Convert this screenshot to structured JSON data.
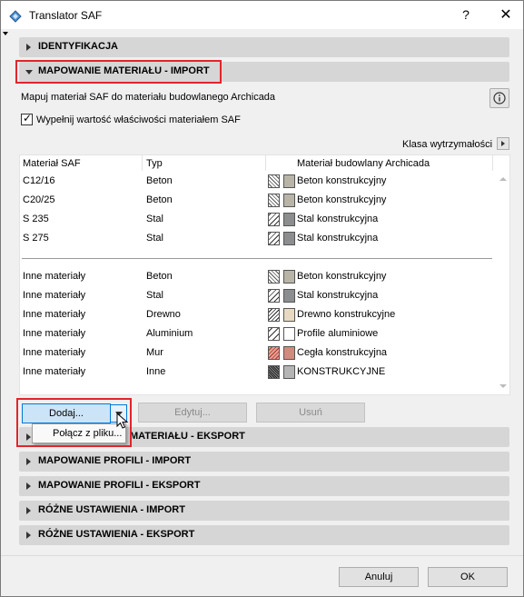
{
  "window": {
    "title": "Translator SAF",
    "help_label": "?",
    "close_label": "✕"
  },
  "sections": {
    "identyfikacja": "IDENTYFIKACJA",
    "mapowanie_import": "MAPOWANIE MATERIAŁU - IMPORT",
    "mapowanie_eksport": "MATERIAŁU - EKSPORT",
    "profile_import": "MAPOWANIE PROFILI - IMPORT",
    "profile_eksport": "MAPOWANIE PROFILI - EKSPORT",
    "rozne_import": "RÓŻNE USTAWIENIA - IMPORT",
    "rozne_eksport": "RÓŻNE USTAWIENIA - EKSPORT"
  },
  "description": "Mapuj materiał SAF do materiału budowlanego Archicada",
  "checkbox_label": "Wypełnij wartość właściwości materiałem SAF",
  "klasa_label": "Klasa wytrzymałości",
  "table": {
    "headers": [
      "Materiał SAF",
      "Typ",
      "Materiał budowlany Archicada"
    ],
    "rows": [
      {
        "saf": "C12/16",
        "typ": "Beton",
        "material": "Beton konstrukcyjny"
      },
      {
        "saf": "C20/25",
        "typ": "Beton",
        "material": "Beton konstrukcyjny"
      },
      {
        "saf": "S 235",
        "typ": "Stal",
        "material": "Stal konstrukcyjna"
      },
      {
        "saf": "S 275",
        "typ": "Stal",
        "material": "Stal konstrukcyjna"
      }
    ],
    "other_rows": [
      {
        "saf": "Inne materiały",
        "typ": "Beton",
        "material": "Beton konstrukcyjny"
      },
      {
        "saf": "Inne materiały",
        "typ": "Stal",
        "material": "Stal konstrukcyjna"
      },
      {
        "saf": "Inne materiały",
        "typ": "Drewno",
        "material": "Drewno konstrukcyjne"
      },
      {
        "saf": "Inne materiały",
        "typ": "Aluminium",
        "material": "Profile aluminiowe"
      },
      {
        "saf": "Inne materiały",
        "typ": "Mur",
        "material": "Cegła konstrukcyjna"
      },
      {
        "saf": "Inne materiały",
        "typ": "Inne",
        "material": "KONSTRUKCYJNE"
      }
    ]
  },
  "buttons": {
    "dodaj": "Dodaj...",
    "edytuj": "Edytuj...",
    "usun": "Usuń",
    "anuluj": "Anuluj",
    "ok": "OK"
  },
  "menu": {
    "polacz": "Połącz z pliku..."
  },
  "colors": {
    "highlight": "#e0262b",
    "section_bg": "#d6d6d6",
    "accent": "#0078d7"
  }
}
